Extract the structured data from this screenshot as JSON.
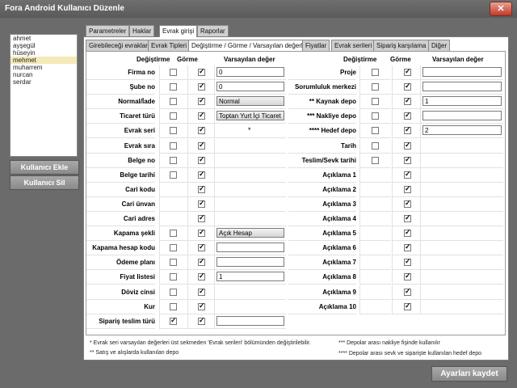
{
  "window": {
    "title": "Fora Android Kullanıcı Düzenle",
    "close_label": "✕"
  },
  "users": [
    "ahmet",
    "ayşegül",
    "hüseyin",
    "mehmet",
    "muharrem",
    "nurcan",
    "serdar"
  ],
  "selected_user": "mehmet",
  "buttons": {
    "add_user": "Kullanıcı Ekle",
    "delete_user": "Kullanıcı Sil",
    "save": "Ayarları kaydet"
  },
  "main_tabs": [
    "Parametreler",
    "Haklar",
    "Evrak girişi",
    "Raporlar"
  ],
  "main_tab_active": "Evrak girişi",
  "sub_tabs": [
    "Girebileceği evraklar",
    "Evrak Tipleri",
    "Değiştirme / Görme / Varsayılan değerler",
    "Fiyatlar",
    "Evrak serileri",
    "Sipariş karşılama",
    "Diğer"
  ],
  "sub_tab_active": "Değiştirme / Görme / Varsayılan değerler",
  "headers": {
    "change": "Değiştirme",
    "see": "Görme",
    "default": "Varsayılan değer"
  },
  "left_rows": [
    {
      "label": "Firma no",
      "change": false,
      "see": true,
      "kind": "text",
      "value": "0"
    },
    {
      "label": "Şube no",
      "change": false,
      "see": true,
      "kind": "text",
      "value": "0"
    },
    {
      "label": "Normal/İade",
      "change": false,
      "see": true,
      "kind": "combo",
      "value": "Normal"
    },
    {
      "label": "Ticaret türü",
      "change": false,
      "see": true,
      "kind": "combo",
      "value": "Toptan Yurt İçi Ticaret"
    },
    {
      "label": "Evrak seri",
      "change": false,
      "see": true,
      "kind": "star",
      "value": "*"
    },
    {
      "label": "Evrak sıra",
      "change": false,
      "see": true,
      "kind": "none",
      "value": ""
    },
    {
      "label": "Belge no",
      "change": false,
      "see": true,
      "kind": "none",
      "value": ""
    },
    {
      "label": "Belge tarihi",
      "change": false,
      "see": true,
      "kind": "none",
      "value": ""
    },
    {
      "label": "Cari kodu",
      "change": null,
      "see": true,
      "kind": "none",
      "value": ""
    },
    {
      "label": "Cari ünvan",
      "change": null,
      "see": true,
      "kind": "none",
      "value": ""
    },
    {
      "label": "Cari adres",
      "change": null,
      "see": true,
      "kind": "none",
      "value": ""
    },
    {
      "label": "Kapama şekli",
      "change": false,
      "see": true,
      "kind": "combo",
      "value": "Açık Hesap"
    },
    {
      "label": "Kapama hesap kodu",
      "change": false,
      "see": true,
      "kind": "text",
      "value": ""
    },
    {
      "label": "Ödeme planı",
      "change": false,
      "see": true,
      "kind": "text",
      "value": ""
    },
    {
      "label": "Fiyat listesi",
      "change": false,
      "see": true,
      "kind": "text",
      "value": "1"
    },
    {
      "label": "Döviz cinsi",
      "change": false,
      "see": true,
      "kind": "none",
      "value": ""
    },
    {
      "label": "Kur",
      "change": false,
      "see": true,
      "kind": "none",
      "value": ""
    },
    {
      "label": "Sipariş teslim türü",
      "change": true,
      "see": true,
      "kind": "text",
      "value": ""
    }
  ],
  "right_rows": [
    {
      "label": "Proje",
      "change": false,
      "see": true,
      "kind": "text",
      "value": ""
    },
    {
      "label": "Sorumluluk merkezi",
      "change": false,
      "see": true,
      "kind": "text",
      "value": ""
    },
    {
      "label": "** Kaynak depo",
      "change": false,
      "see": true,
      "kind": "text",
      "value": "1"
    },
    {
      "label": "*** Nakliye depo",
      "change": false,
      "see": true,
      "kind": "text",
      "value": ""
    },
    {
      "label": "**** Hedef depo",
      "change": false,
      "see": true,
      "kind": "text",
      "value": "2"
    },
    {
      "label": "Tarih",
      "change": false,
      "see": true,
      "kind": "none",
      "value": ""
    },
    {
      "label": "Teslim/Sevk tarihi",
      "change": false,
      "see": true,
      "kind": "none",
      "value": ""
    },
    {
      "label": "Açıklama 1",
      "change": null,
      "see": true,
      "kind": "none",
      "value": ""
    },
    {
      "label": "Açıklama 2",
      "change": null,
      "see": true,
      "kind": "none",
      "value": ""
    },
    {
      "label": "Açıklama 3",
      "change": null,
      "see": true,
      "kind": "none",
      "value": ""
    },
    {
      "label": "Açıklama 4",
      "change": null,
      "see": true,
      "kind": "none",
      "value": ""
    },
    {
      "label": "Açıklama 5",
      "change": null,
      "see": true,
      "kind": "none",
      "value": ""
    },
    {
      "label": "Açıklama 6",
      "change": null,
      "see": true,
      "kind": "none",
      "value": ""
    },
    {
      "label": "Açıklama 7",
      "change": null,
      "see": true,
      "kind": "none",
      "value": ""
    },
    {
      "label": "Açıklama 8",
      "change": null,
      "see": true,
      "kind": "none",
      "value": ""
    },
    {
      "label": "Açıklama 9",
      "change": null,
      "see": true,
      "kind": "none",
      "value": ""
    },
    {
      "label": "Açıklama 10",
      "change": null,
      "see": true,
      "kind": "none",
      "value": ""
    }
  ],
  "notes": {
    "n1": "* Evrak seri varsayılan değerleri üst sekmeden 'Evrak serileri' bölümünden değiştirilebilir.",
    "n2": "** Satış ve alışlarda kullanılan depo",
    "n3": "*** Depolar arası nakliye fişinde kullanılır",
    "n4": "**** Depolar arası sevk ve siparişte kullanılan hedef depo"
  }
}
